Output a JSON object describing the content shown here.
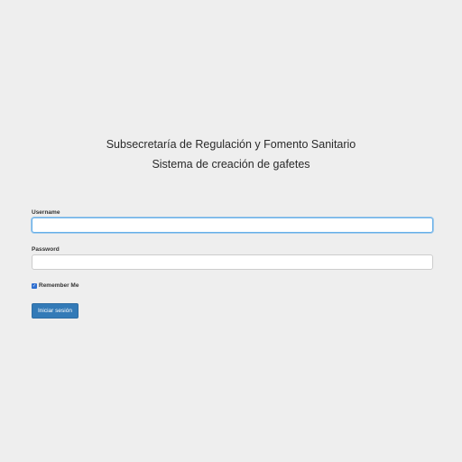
{
  "header": {
    "organization": "Subsecretaría de Regulación y Fomento Sanitario",
    "system_title": "Sistema de creación de gafetes"
  },
  "login_form": {
    "username_label": "Username",
    "username_value": "",
    "password_label": "Password",
    "password_value": "",
    "remember_label": "Remember Me",
    "remember_checked": true,
    "submit_label": "Iniciar sesión"
  },
  "colors": {
    "background": "#eeeeee",
    "primary_button": "#337ab7",
    "focus_border": "#66afe9",
    "checkbox": "#2f6fd0"
  }
}
